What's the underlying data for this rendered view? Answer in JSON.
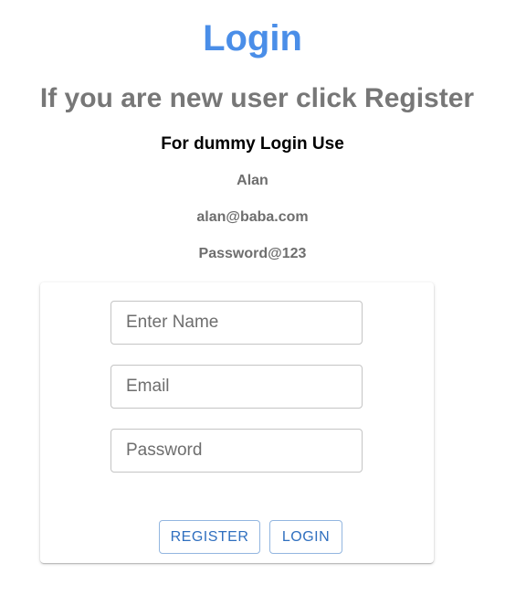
{
  "header": {
    "title": "Login",
    "subtitle": "If you are new user click Register"
  },
  "dummy": {
    "heading": "For dummy Login Use",
    "name": "Alan",
    "email": "alan@baba.com",
    "password": "Password@123"
  },
  "form": {
    "name_placeholder": "Enter Name",
    "email_placeholder": "Email",
    "password_placeholder": "Password",
    "name_value": "",
    "email_value": "",
    "password_value": ""
  },
  "buttons": {
    "register_label": "REGISTER",
    "login_label": "LOGIN"
  },
  "colors": {
    "title": "#4a8ee8",
    "subtitle": "#777777",
    "button_text": "#2f6fbf",
    "button_border": "#93b6e0"
  }
}
